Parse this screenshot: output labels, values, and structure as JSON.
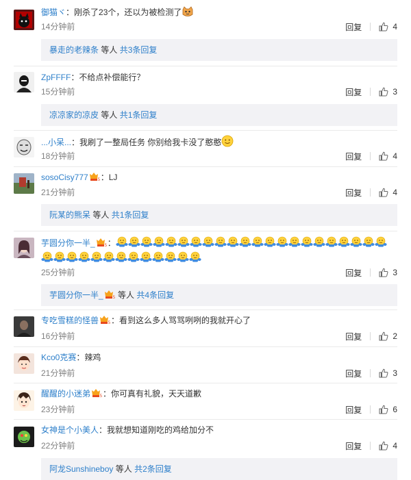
{
  "colors": {
    "username_orange": "#eb7350",
    "link_blue": "#2d7fca",
    "meta_gray": "#808080",
    "subbox_bg": "#f2f2f5"
  },
  "labels": {
    "reply": "回复",
    "mid_text": "等人",
    "total_prefix": "共",
    "total_suffix": "条回复"
  },
  "comments": [
    {
      "user": "御猫ヾ",
      "text": "刚杀了23个，还以为被检测了",
      "time": "14分钟前",
      "likes": "4",
      "avatar_icon": "black-cat-icon",
      "emoji_icon": "cat-face-emoji-icon",
      "sub_user": "暴走的老辣条",
      "sub_count": "3"
    },
    {
      "user": "ZpFFFF",
      "text": "不给点补偿能行？",
      "time": "15分钟前",
      "likes": "3",
      "avatar_icon": "dark-figure-icon",
      "sub_user": "凉凉家的凉皮",
      "sub_count": "1"
    },
    {
      "user": "...小呆...",
      "text": "我刷了一整局任务 你别给我卡没了憨憨",
      "time": "18分钟前",
      "likes": "4",
      "avatar_icon": "meme-face-icon",
      "emoji_icon": "smile-emoji-icon"
    },
    {
      "user": "sosoCisy777",
      "text": "LJ",
      "time": "21分钟前",
      "likes": "4",
      "avatar_icon": "landscape-icon",
      "badge_icon": "vip-badge-icon",
      "sub_user": "阮某的熊呆",
      "sub_count": "1"
    },
    {
      "user": "芋圆分你一半_",
      "text": "",
      "time": "25分钟前",
      "likes": "3",
      "avatar_icon": "girl-portrait-icon",
      "badge_icon": "vip-badge-icon",
      "emoji_icon": "hug-emoji-icon",
      "emoji_count_row1": 22,
      "emoji_count_row2": 13,
      "sub_user": "芋圆分你一半_",
      "sub_badge_icon": "vip-badge-icon",
      "sub_count": "4"
    },
    {
      "user": "专吃雪糕的怪兽",
      "text": "看到这么多人骂骂咧咧的我就开心了",
      "time": "16分钟前",
      "likes": "2",
      "avatar_icon": "dark-portrait-icon",
      "badge_icon": "vip-badge-icon"
    },
    {
      "user": "Kco0克赛",
      "text": "辣鸡",
      "time": "21分钟前",
      "likes": "3",
      "avatar_icon": "cartoon-girl-icon"
    },
    {
      "user": "醒醒的小迷弟",
      "text": "你可真有礼貌，天天道歉",
      "time": "23分钟前",
      "likes": "6",
      "avatar_icon": "anime-boy-icon",
      "badge_icon": "vip-badge-icon"
    },
    {
      "user": "女神是个小美人",
      "text": "我就想知道刚吃的鸡给加分不",
      "time": "22分钟前",
      "likes": "4",
      "avatar_icon": "green-creature-icon",
      "sub_user": "阿龙Sunshineboy",
      "sub_count": "2"
    }
  ]
}
